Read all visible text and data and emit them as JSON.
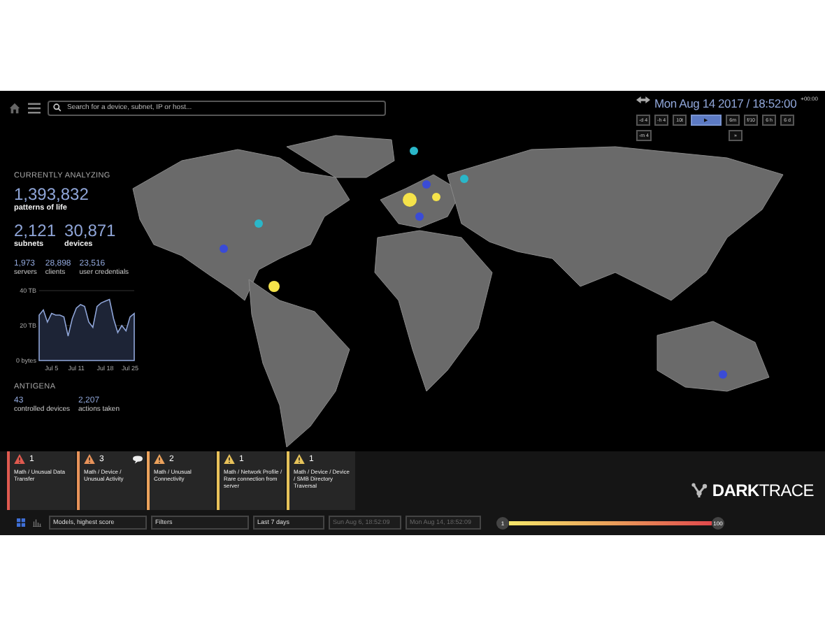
{
  "header": {
    "search": {
      "placeholder": "Search for a device, subnet, IP or host..."
    },
    "datetime": "Mon Aug 14 2017 / 18:52:00",
    "timezone": "+00:00",
    "playback_controls": [
      {
        "label": "-d 4",
        "selected": false
      },
      {
        "label": "-h 4",
        "selected": false
      },
      {
        "label": "10t",
        "selected": false
      },
      {
        "label": "▶",
        "selected": true
      },
      {
        "label": "6m",
        "selected": false
      },
      {
        "label": "f/10",
        "selected": false
      },
      {
        "label": "6 h",
        "selected": false
      },
      {
        "label": "6 d",
        "selected": false
      }
    ],
    "playback_controls_row_2": [
      {
        "label": "-m 4",
        "selected": false
      },
      {
        "label": "»",
        "selected": false
      }
    ]
  },
  "stats": {
    "heading": "CURRENTLY ANALYZING",
    "patterns": {
      "value": "1,393,832",
      "label": "patterns of life"
    },
    "primary": [
      {
        "value": "2,121",
        "label": "subnets"
      },
      {
        "value": "30,871",
        "label": "devices"
      }
    ],
    "secondary": [
      {
        "value": "1,973",
        "label": "servers"
      },
      {
        "value": "28,898",
        "label": "clients"
      },
      {
        "value": "23,516",
        "label": "user credentials"
      }
    ],
    "chart_data": {
      "type": "area",
      "categories": [
        null,
        null,
        null,
        "Jul 5",
        null,
        null,
        null,
        null,
        null,
        "Jul 11",
        null,
        null,
        null,
        null,
        null,
        null,
        "Jul 18",
        null,
        null,
        null,
        null,
        null,
        "Jul 25",
        null
      ],
      "values": [
        26,
        29,
        22,
        27,
        26,
        26,
        25,
        14,
        24,
        30,
        32,
        31,
        22,
        19,
        31,
        33,
        34,
        35,
        24,
        16,
        20,
        17,
        25,
        27
      ],
      "ylim": [
        0,
        40
      ],
      "yticks": [
        {
          "value": 0,
          "label": "0 bytes"
        },
        {
          "value": 20,
          "label": "20 TB"
        },
        {
          "value": 40,
          "label": "40 TB"
        }
      ]
    },
    "antigena_heading": "ANTIGENA",
    "antigena": [
      {
        "value": "43",
        "label": "controlled devices"
      },
      {
        "value": "2,207",
        "label": "actions taken"
      }
    ]
  },
  "alerts": [
    {
      "count": "1",
      "title": "Math / Unusual Data Transfer",
      "color": "#e05a4f",
      "comment": false
    },
    {
      "count": "3",
      "title": "Math / Device / Unusual Activity",
      "color": "#e8935a",
      "comment": true
    },
    {
      "count": "2",
      "title": "Math / Unusual Connectivity",
      "color": "#eca25c",
      "comment": false
    },
    {
      "count": "1",
      "title": "Math / Network Profile / Rare connection from server",
      "color": "#e9c25a",
      "comment": false
    },
    {
      "count": "1",
      "title": "Math / Device / Device / SMB Directory Traversal",
      "color": "#e6c35a",
      "comment": false
    }
  ],
  "logo": {
    "bold": "DARK",
    "light": "TRACE"
  },
  "bottom_bar": {
    "sort": "Models, highest score",
    "filters": "Filters",
    "range": "Last 7 days",
    "from": "Sun Aug 6, 18:52:09",
    "to": "Mon Aug 14, 18:52:09",
    "score_min": "1",
    "score_max": "100"
  }
}
